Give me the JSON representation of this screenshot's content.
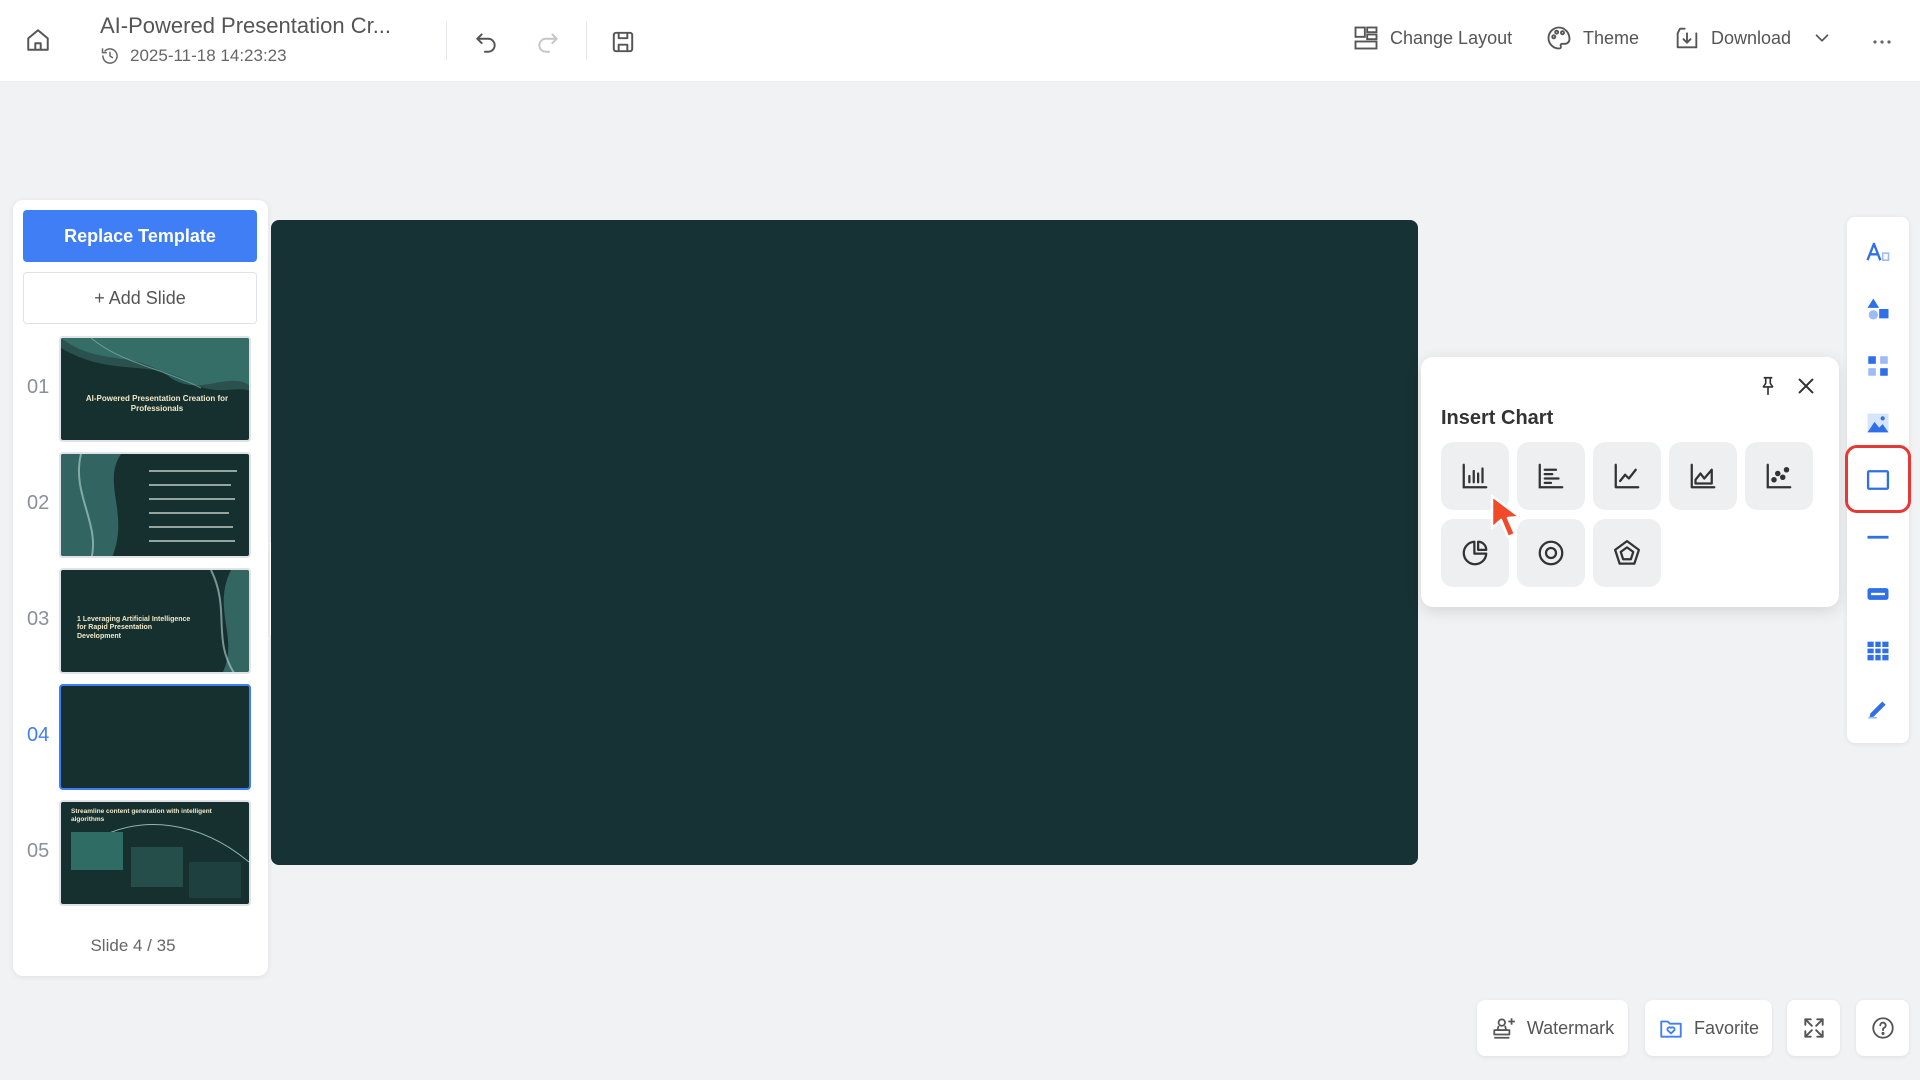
{
  "header": {
    "doc_title": "AI-Powered Presentation Cr...",
    "timestamp": "2025-11-18 14:23:23",
    "change_layout_label": "Change Layout",
    "theme_label": "Theme",
    "download_label": "Download"
  },
  "left_panel": {
    "replace_template_label": "Replace Template",
    "add_slide_label": "+ Add Slide",
    "slides": [
      {
        "number": "01",
        "title": "AI-Powered Presentation Creation for Professionals"
      },
      {
        "number": "02",
        "title": ""
      },
      {
        "number": "03",
        "title": "1 Leveraging Artificial Intelligence for Rapid Presentation Development"
      },
      {
        "number": "04",
        "title": ""
      },
      {
        "number": "05",
        "title": "Streamline content generation with intelligent algorithms"
      }
    ],
    "active_slide": "04",
    "slide_counter": "Slide 4 / 35"
  },
  "chart_popup": {
    "title": "Insert Chart",
    "chart_types": [
      "column-chart",
      "bar-chart",
      "line-chart",
      "area-chart",
      "scatter-chart",
      "pie-chart",
      "ring-chart",
      "radar-chart"
    ]
  },
  "right_toolbar": {
    "tools": [
      "text-tool",
      "shape-tool",
      "component-tool",
      "image-tool",
      "chart-tool",
      "divider-tool",
      "button-tool",
      "table-tool",
      "draw-tool"
    ],
    "highlighted": "chart-tool"
  },
  "bottom": {
    "watermark_label": "Watermark",
    "favorite_label": "Favorite"
  },
  "colors": {
    "accent": "#3f7ef4",
    "slide_bg": "#173234",
    "highlight": "#e53935",
    "cursor": "#f04a2a"
  }
}
